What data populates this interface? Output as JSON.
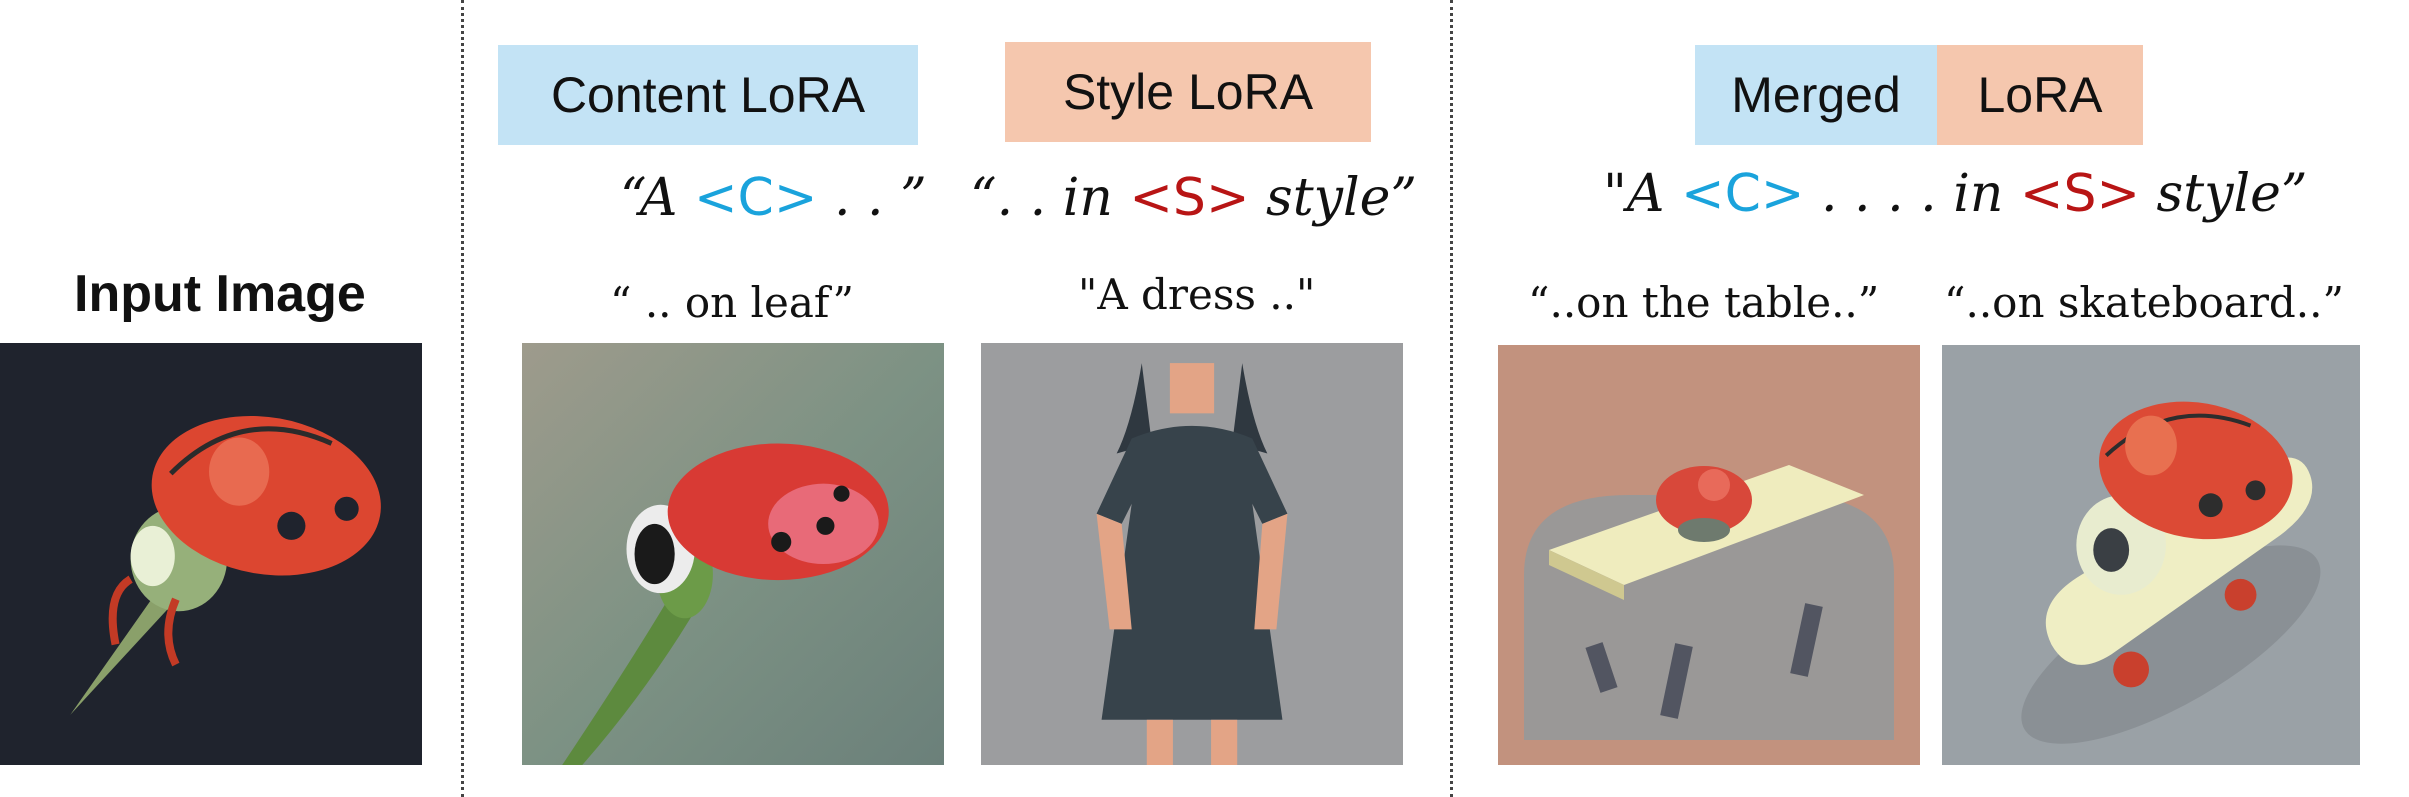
{
  "input": {
    "title": "Input Image"
  },
  "content_lora": {
    "label": "Content LoRA",
    "prompt_open": "“A ",
    "token": "<C>",
    "prompt_close": " . .  ”",
    "caption": "“ .. on leaf”"
  },
  "style_lora": {
    "label": "Style LoRA",
    "prompt_open": "“. . in ",
    "token": "<S>",
    "prompt_close": " style”",
    "caption": "\"A dress ..\""
  },
  "merged": {
    "label_left": "Merged",
    "label_right": "LoRA",
    "prompt_open": "\"A ",
    "token_c": "<C>",
    "prompt_mid": " . . . . in ",
    "token_s": "<S>",
    "prompt_close": " style”",
    "caption_left": "“..on the table..”",
    "caption_right": "“..on skateboard..”"
  },
  "colors": {
    "content_box": "#c3e3f5",
    "style_box": "#f5c7ae",
    "token_c": "#1aa3dc",
    "token_s": "#b81515"
  }
}
